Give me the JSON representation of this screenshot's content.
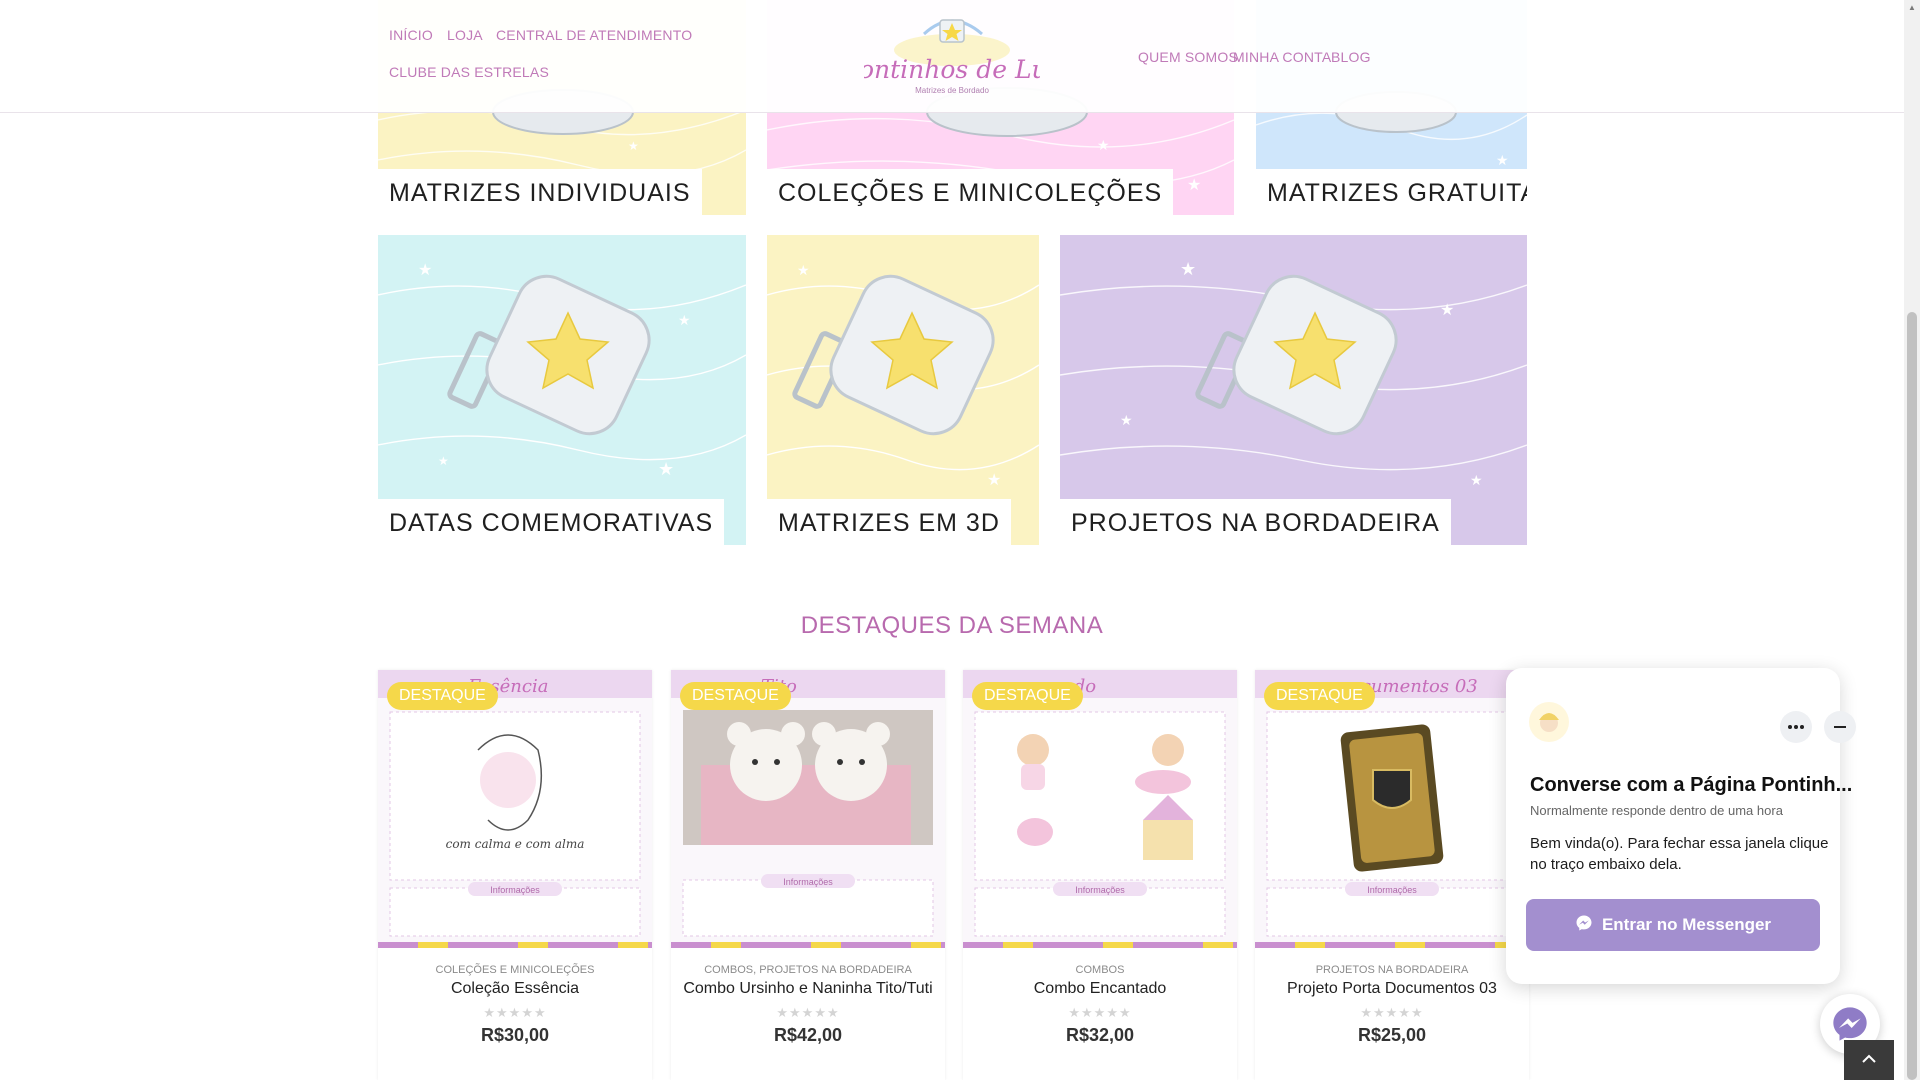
{
  "header": {
    "nav_left_row1": [
      "INÍCIO",
      "LOJA",
      "CENTRAL DE ATENDIMENTO"
    ],
    "nav_left_row2": [
      "CLUBE DAS ESTRELAS"
    ],
    "nav_right": [
      "QUEM SOMOS",
      "MINHA CONTA",
      "BLOG"
    ],
    "logo_title": "Pontinhos de Luz",
    "logo_tagline": "Matrizes de Bordado"
  },
  "categories": [
    {
      "label": "MATRIZES INDIVIDUAIS",
      "color": "#fbf3c3"
    },
    {
      "label": "COLEÇÕES E MINICOLEÇÕES",
      "color": "#ffd5f3"
    },
    {
      "label": "MATRIZES GRATUITAS",
      "color": "#cfe6fb"
    },
    {
      "label": "DATAS COMEMORATIVAS",
      "color": "#d3f3f4"
    },
    {
      "label": "MATRIZES EM 3D",
      "color": "#fbf3c3"
    },
    {
      "label": "PROJETOS NA BORDADEIRA",
      "color": "#d7c8ea"
    }
  ],
  "featured": {
    "title": "DESTAQUES DA SEMANA",
    "products": [
      {
        "badge": "DESTAQUE",
        "category": "COLEÇÕES E MINICOLEÇÕES",
        "name": "Coleção Essência",
        "rating": 0,
        "price": "R$30,00",
        "banner": "Essência",
        "image_caption": "com calma e com alma"
      },
      {
        "badge": "DESTAQUE",
        "category": "COMBOS, PROJETOS NA BORDADEIRA",
        "name": "Combo Ursinho e Naninha Tito/Tuti",
        "rating": 0,
        "price": "R$42,00",
        "banner": "Tito"
      },
      {
        "badge": "DESTAQUE",
        "category": "COMBOS",
        "name": "Combo Encantado",
        "rating": 0,
        "price": "R$32,00",
        "banner": "ado"
      },
      {
        "badge": "DESTAQUE",
        "category": "PROJETOS NA BORDADEIRA",
        "name": "Projeto Porta Documentos 03",
        "rating": 0,
        "price": "R$25,00",
        "banner": "ocumentos 03"
      }
    ],
    "info_label": "Informações"
  },
  "messenger": {
    "title": "Converse com a Página Pontinh...",
    "subtitle": "Normalmente responde dentro de uma hora",
    "message": "Bem vinda(o). Para fechar essa janela clique no traço embaixo dela.",
    "button": "Entrar no Messenger"
  },
  "colors": {
    "accent_pink": "#c07ab8",
    "badge_yellow": "#f5d84a",
    "messenger_purple": "#a38fcf"
  },
  "icons": [
    "more-options-icon",
    "minimize-icon",
    "messenger-icon",
    "chevron-up-icon",
    "star-rating-icon"
  ]
}
